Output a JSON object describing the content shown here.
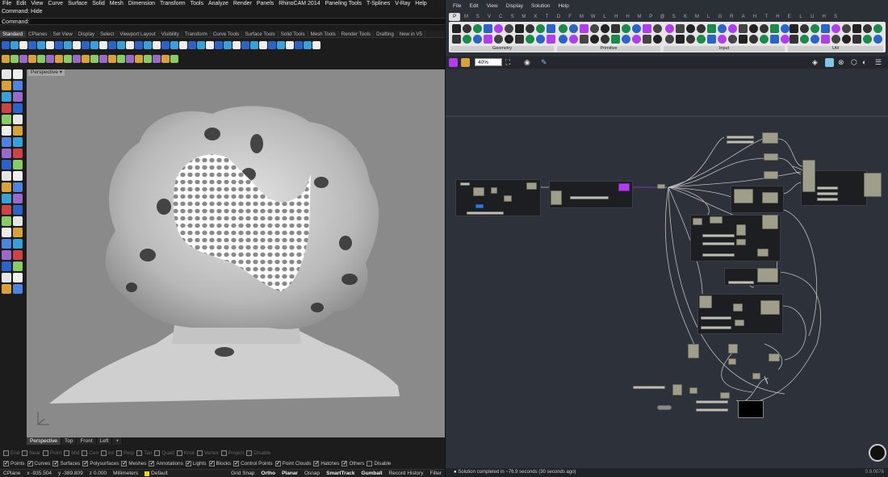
{
  "rhino": {
    "menu": [
      "File",
      "Edit",
      "View",
      "Curve",
      "Surface",
      "Solid",
      "Mesh",
      "Dimension",
      "Transform",
      "Tools",
      "Analyze",
      "Render",
      "Panels",
      "RhinoCAM 2014",
      "Paneling Tools",
      "T-Splines",
      "V-Ray",
      "Help"
    ],
    "command_history": "Command: Hide",
    "command_prompt": "Command:",
    "toolbar_tabs": [
      "Standard",
      "CPlanes",
      "Set View",
      "Display",
      "Select",
      "Viewport Layout",
      "Visibility",
      "Transform",
      "Curve Tools",
      "Surface Tools",
      "Solid Tools",
      "Mesh Tools",
      "Render Tools",
      "Drafting",
      "New in V5"
    ],
    "active_toolbar_tab": "Standard",
    "viewport": {
      "title": "Perspective",
      "tabs": [
        "Perspective",
        "Top",
        "Front",
        "Left"
      ],
      "active_tab": "Perspective",
      "add_tab_icon": "+"
    },
    "osnap_row": [
      {
        "label": "End",
        "on": false
      },
      {
        "label": "Near",
        "on": false
      },
      {
        "label": "Point",
        "on": false
      },
      {
        "label": "Mid",
        "on": false
      },
      {
        "label": "Cen",
        "on": false
      },
      {
        "label": "Int",
        "on": false
      },
      {
        "label": "Perp",
        "on": false
      },
      {
        "label": "Tan",
        "on": false
      },
      {
        "label": "Quad",
        "on": false
      },
      {
        "label": "Knot",
        "on": false
      },
      {
        "label": "Vertex",
        "on": false
      },
      {
        "label": "Project",
        "on": false
      },
      {
        "label": "Disable",
        "on": false
      }
    ],
    "filter_row": [
      {
        "label": "Points",
        "on": true
      },
      {
        "label": "Curves",
        "on": true
      },
      {
        "label": "Surfaces",
        "on": true
      },
      {
        "label": "Polysurfaces",
        "on": true
      },
      {
        "label": "Meshes",
        "on": true
      },
      {
        "label": "Annotations",
        "on": true
      },
      {
        "label": "Lights",
        "on": true
      },
      {
        "label": "Blocks",
        "on": true
      },
      {
        "label": "Control Points",
        "on": true
      },
      {
        "label": "Point Clouds",
        "on": true
      },
      {
        "label": "Hatches",
        "on": true
      },
      {
        "label": "Others",
        "on": true
      },
      {
        "label": "Disable",
        "on": false
      }
    ],
    "status": {
      "cplane": "CPlane",
      "x": "x -935.504",
      "y": "y -389.809",
      "z": "z 0.000",
      "units": "Millimeters",
      "layer": "Default",
      "grid_snap": "Grid Snap",
      "ortho": "Ortho",
      "planar": "Planar",
      "osnap": "Osnap",
      "smarttrack": "SmartTrack",
      "gumball": "Gumball",
      "record_history": "Record History",
      "filter": "Filter"
    }
  },
  "grasshopper": {
    "menu": [
      "File",
      "Edit",
      "View",
      "Display",
      "Solution",
      "Help"
    ],
    "component_tabs": [
      "P",
      "M",
      "S",
      "V",
      "C",
      "S",
      "M",
      "X",
      "T",
      "D",
      "F",
      "M",
      "W",
      "L",
      "H",
      "H",
      "M",
      "P",
      "@",
      "S",
      "K",
      "M",
      "L",
      "G",
      "R",
      "A",
      "H",
      "T",
      "H",
      "E",
      "L",
      "U",
      "H",
      "S"
    ],
    "active_component_tab": "P",
    "ribbon_groups": [
      "Geometry",
      "Primitive",
      "Input",
      "Util"
    ],
    "zoom": "40%",
    "status_message": "Solution completed in ~76.9 seconds (30 seconds ago)",
    "version": "0.9.0076"
  },
  "colors": {
    "rhino_bg": "#1c1c1c",
    "viewport_bg": "#8a8a8a",
    "gh_canvas": "#2d3139",
    "node": "#9f9e8a",
    "accent_purple": "#b23cf0",
    "accent_blue": "#2b7bd8"
  }
}
